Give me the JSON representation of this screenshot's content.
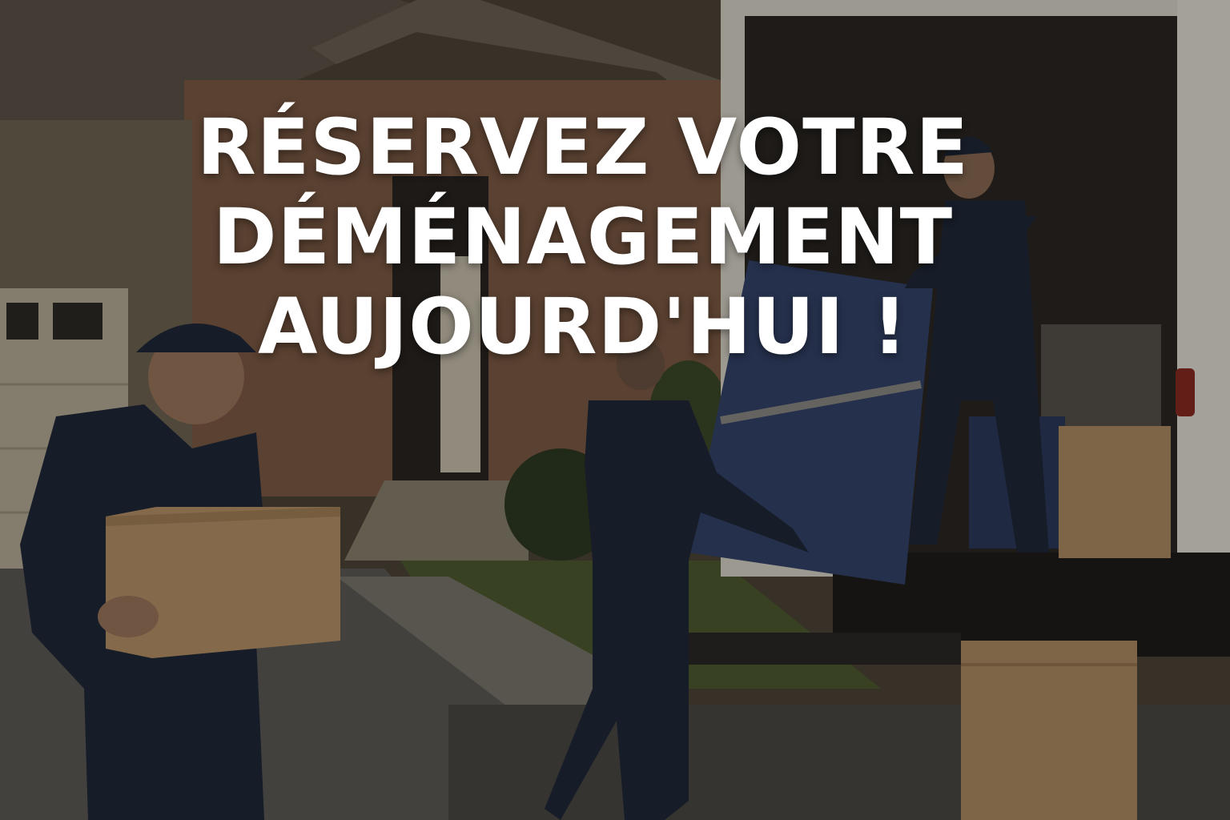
{
  "banner": {
    "headline_lines": [
      "RÉSERVEZ VOTRE",
      "DÉMÉNAGEMENT",
      "AUJOURD'HUI !"
    ],
    "text_color": "#ffffff"
  },
  "photo": {
    "subjects": [
      "moving-truck",
      "mover-carrying-box",
      "mover-carrying-wrapped-furniture",
      "mover-in-truck",
      "cardboard-boxes",
      "brick-house"
    ]
  }
}
